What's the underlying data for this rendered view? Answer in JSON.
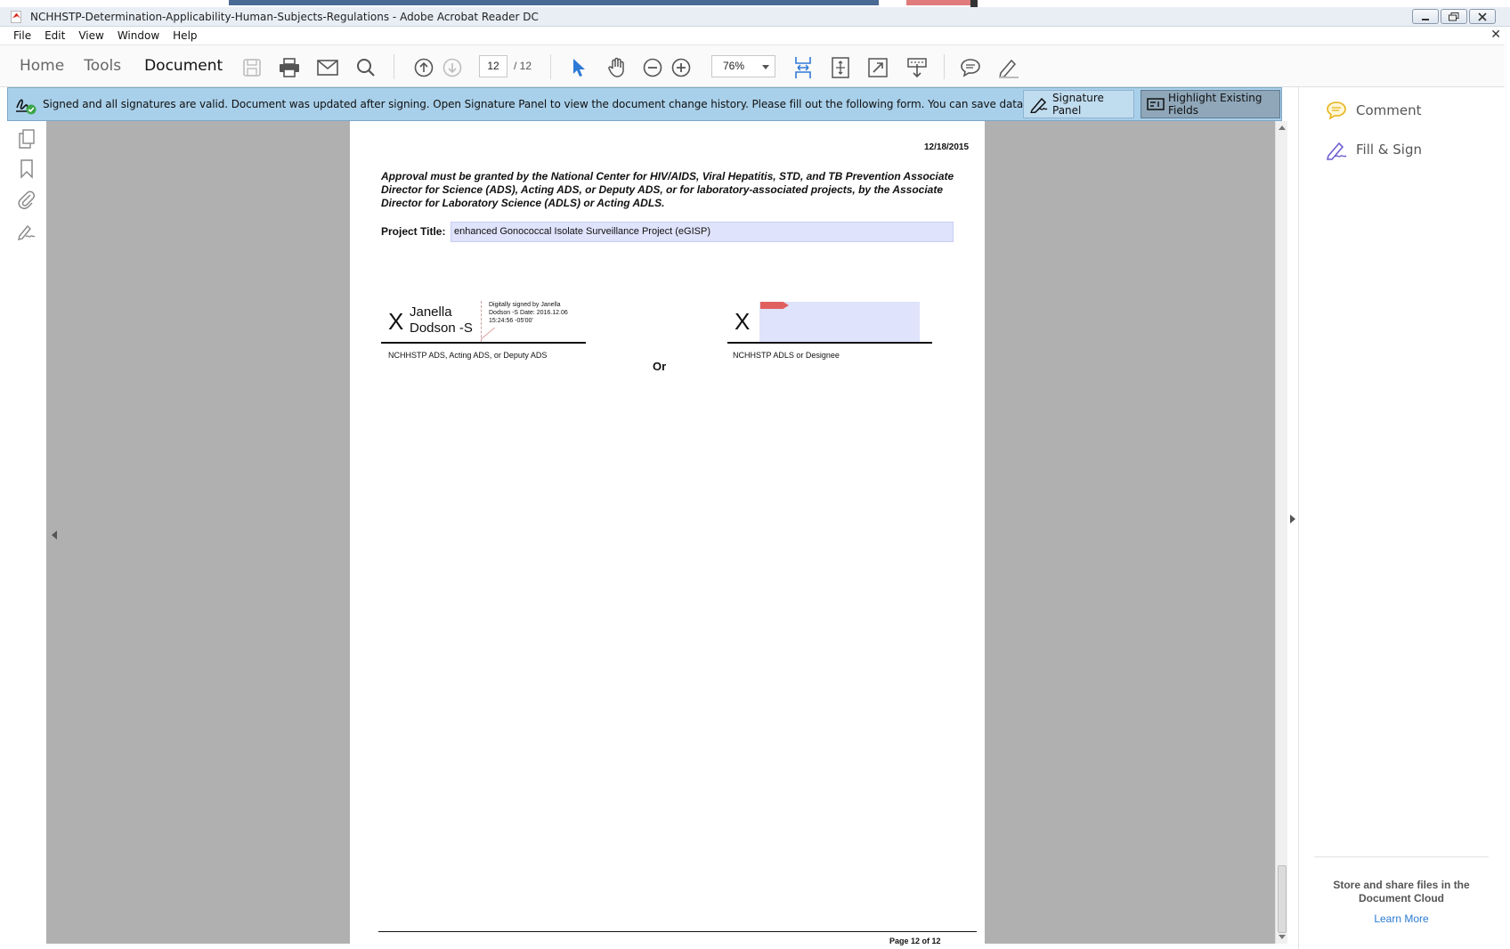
{
  "window": {
    "title": "NCHHSTP-Determination-Applicability-Human-Subjects-Regulations - Adobe Acrobat Reader DC"
  },
  "menu": [
    "File",
    "Edit",
    "View",
    "Window",
    "Help"
  ],
  "toolbar": {
    "tabs": [
      "Home",
      "Tools",
      "Document"
    ],
    "active_tab": "Document",
    "current_page": "12",
    "total_pages": "/ 12",
    "zoom": "76%"
  },
  "signature_bar": {
    "message": "Signed and all signatures are valid. Document was updated after signing. Open Signature Panel to view the document change history.  Please fill out the following form. You can save data typed into this form.",
    "signature_panel_label": "Signature Panel",
    "highlight_label": "Highlight Existing Fields"
  },
  "document": {
    "date": "12/18/2015",
    "approval_text": "Approval must be granted by the National Center for HIV/AIDS, Viral Hepatitis, STD, and TB Prevention Associate Director for Science (ADS), Acting ADS, or Deputy ADS, or for laboratory-associated projects, by the Associate Director for Laboratory Science (ADLS) or Acting ADLS.",
    "project_title_label": "Project Title:",
    "project_title_value": "enhanced Gonococcal Isolate Surveillance Project (eGISP)",
    "signature_left": {
      "x_mark": "X",
      "signer_line1": "Janella",
      "signer_line2": "Dodson -S",
      "stamp": "Digitally signed by Janella Dodson -S Date: 2016.12.06 15:24:56 -05'00'",
      "label": "NCHHSTP ADS, Acting ADS, or Deputy ADS"
    },
    "or_text": "Or",
    "signature_right": {
      "x_mark": "X",
      "label": "NCHHSTP ADLS or Designee"
    },
    "page_footer": "Page 12 of 12"
  },
  "right_pane": {
    "items": [
      "Comment",
      "Fill & Sign"
    ],
    "cloud_text": "Store and share files in the Document Cloud",
    "learn_more": "Learn More"
  },
  "colors": {
    "signature_bar": "#a9d0ea",
    "form_field": "#dfe3fb",
    "doc_background": "#b0b0b0",
    "link": "#2a7ad2"
  }
}
